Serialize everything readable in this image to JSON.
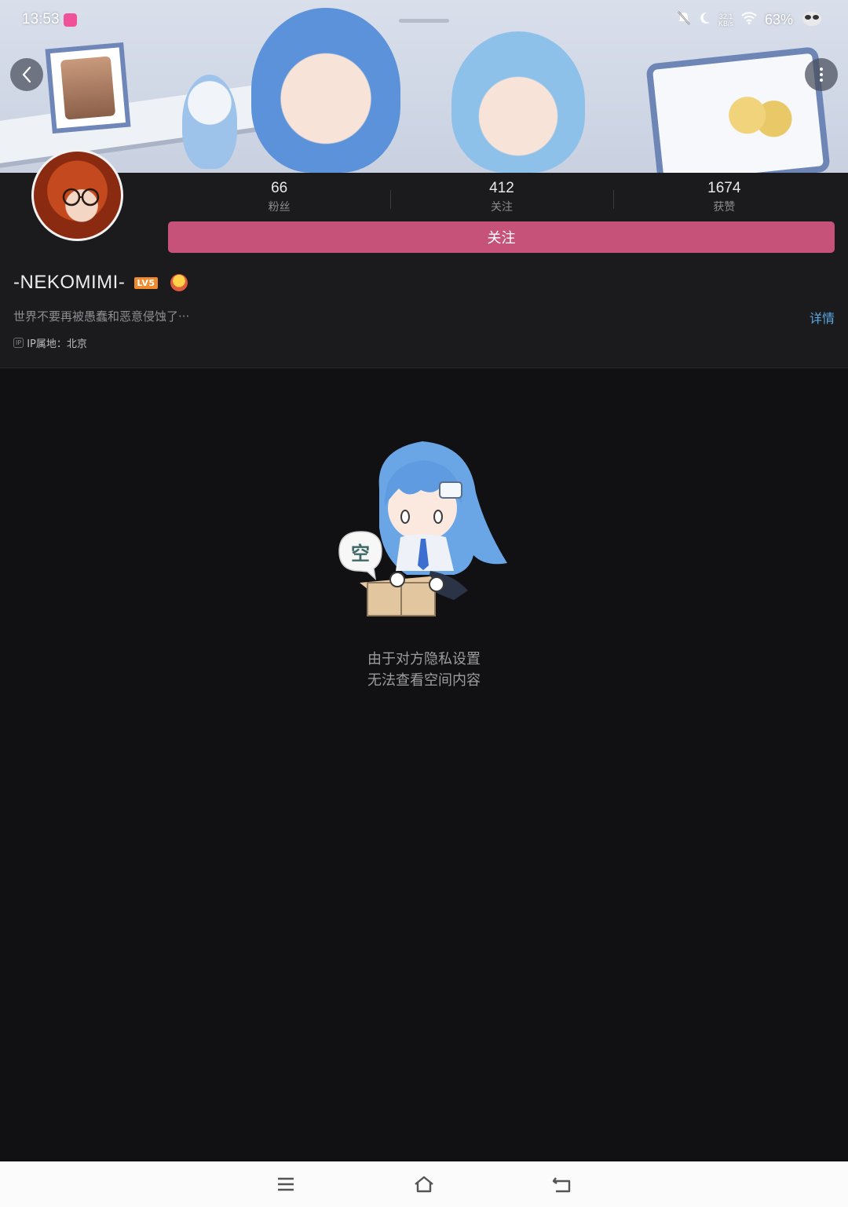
{
  "status_bar": {
    "time": "13:53",
    "net_speed_value": "32.1",
    "net_speed_unit": "KB/s",
    "battery": "63%"
  },
  "header": {
    "back_icon": "chevron-left-icon",
    "more_icon": "more-vertical-icon"
  },
  "profile": {
    "stats": [
      {
        "value": "66",
        "label": "粉丝"
      },
      {
        "value": "412",
        "label": "关注"
      },
      {
        "value": "1674",
        "label": "获赞"
      }
    ],
    "follow_label": "关注",
    "username": "-NEKOMIMI-",
    "level": "LV5",
    "bio": "世界不要再被愚蠢和恶意侵蚀了···",
    "details_label": "详情",
    "ip_badge": "IP",
    "ip_location": "IP属地：北京"
  },
  "empty_state": {
    "bubble_text": "空",
    "line1": "由于对方隐私设置",
    "line2": "无法查看空间内容"
  },
  "colors": {
    "accent": "#c6527a",
    "link": "#5aa7e0",
    "background": "#111113",
    "header_bg": "#1b1b1e"
  }
}
